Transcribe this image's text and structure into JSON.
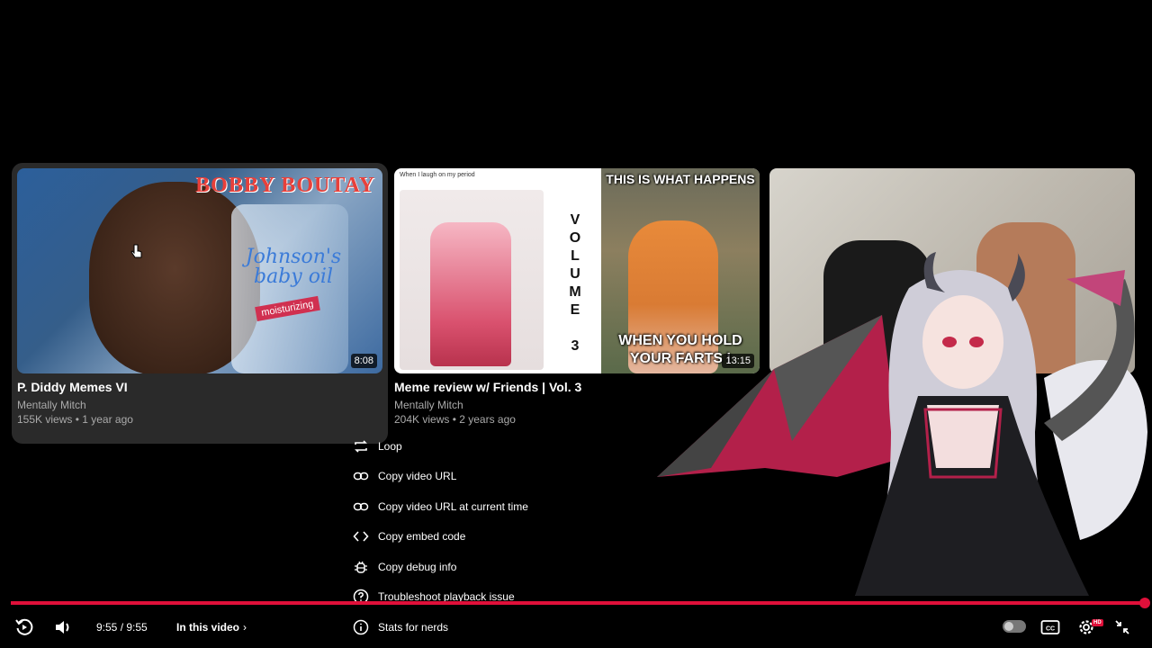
{
  "end_screen": {
    "cards": [
      {
        "title": "P. Diddy Memes VI",
        "channel": "Mentally Mitch",
        "meta": "155K views • 1 year ago",
        "duration": "8:08",
        "thumb_text": {
          "brand": "BOBBY BOUTAY",
          "label": "Johnson's baby oil",
          "sub": "moisturizing"
        }
      },
      {
        "title": "Meme review w/ Friends | Vol. 3",
        "channel": "Mentally Mitch",
        "meta": "204K views • 2 years ago",
        "duration": "13:15",
        "thumb_text": {
          "top": "When I laugh on my period",
          "vertical": "VOLUME 3",
          "caption_top": "THIS IS WHAT HAPPENS",
          "caption_bottom": "WHEN YOU HOLD YOUR FARTS I"
        }
      },
      {
        "title": "",
        "channel": "",
        "meta": "",
        "duration": ""
      }
    ]
  },
  "context_menu": {
    "items": [
      {
        "label": "Loop",
        "icon": "loop-icon"
      },
      {
        "label": "Copy video URL",
        "icon": "link-icon"
      },
      {
        "label": "Copy video URL at current time",
        "icon": "link-icon"
      },
      {
        "label": "Copy embed code",
        "icon": "code-icon"
      },
      {
        "label": "Copy debug info",
        "icon": "bug-icon"
      },
      {
        "label": "Troubleshoot playback issue",
        "icon": "help-icon"
      },
      {
        "label": "Stats for nerds",
        "icon": "info-icon"
      }
    ]
  },
  "player": {
    "time": "9:55 / 9:55",
    "chapter_label": "In this video",
    "progress": 1.0,
    "quality_badge": "HD",
    "accent": "#e0103a"
  }
}
